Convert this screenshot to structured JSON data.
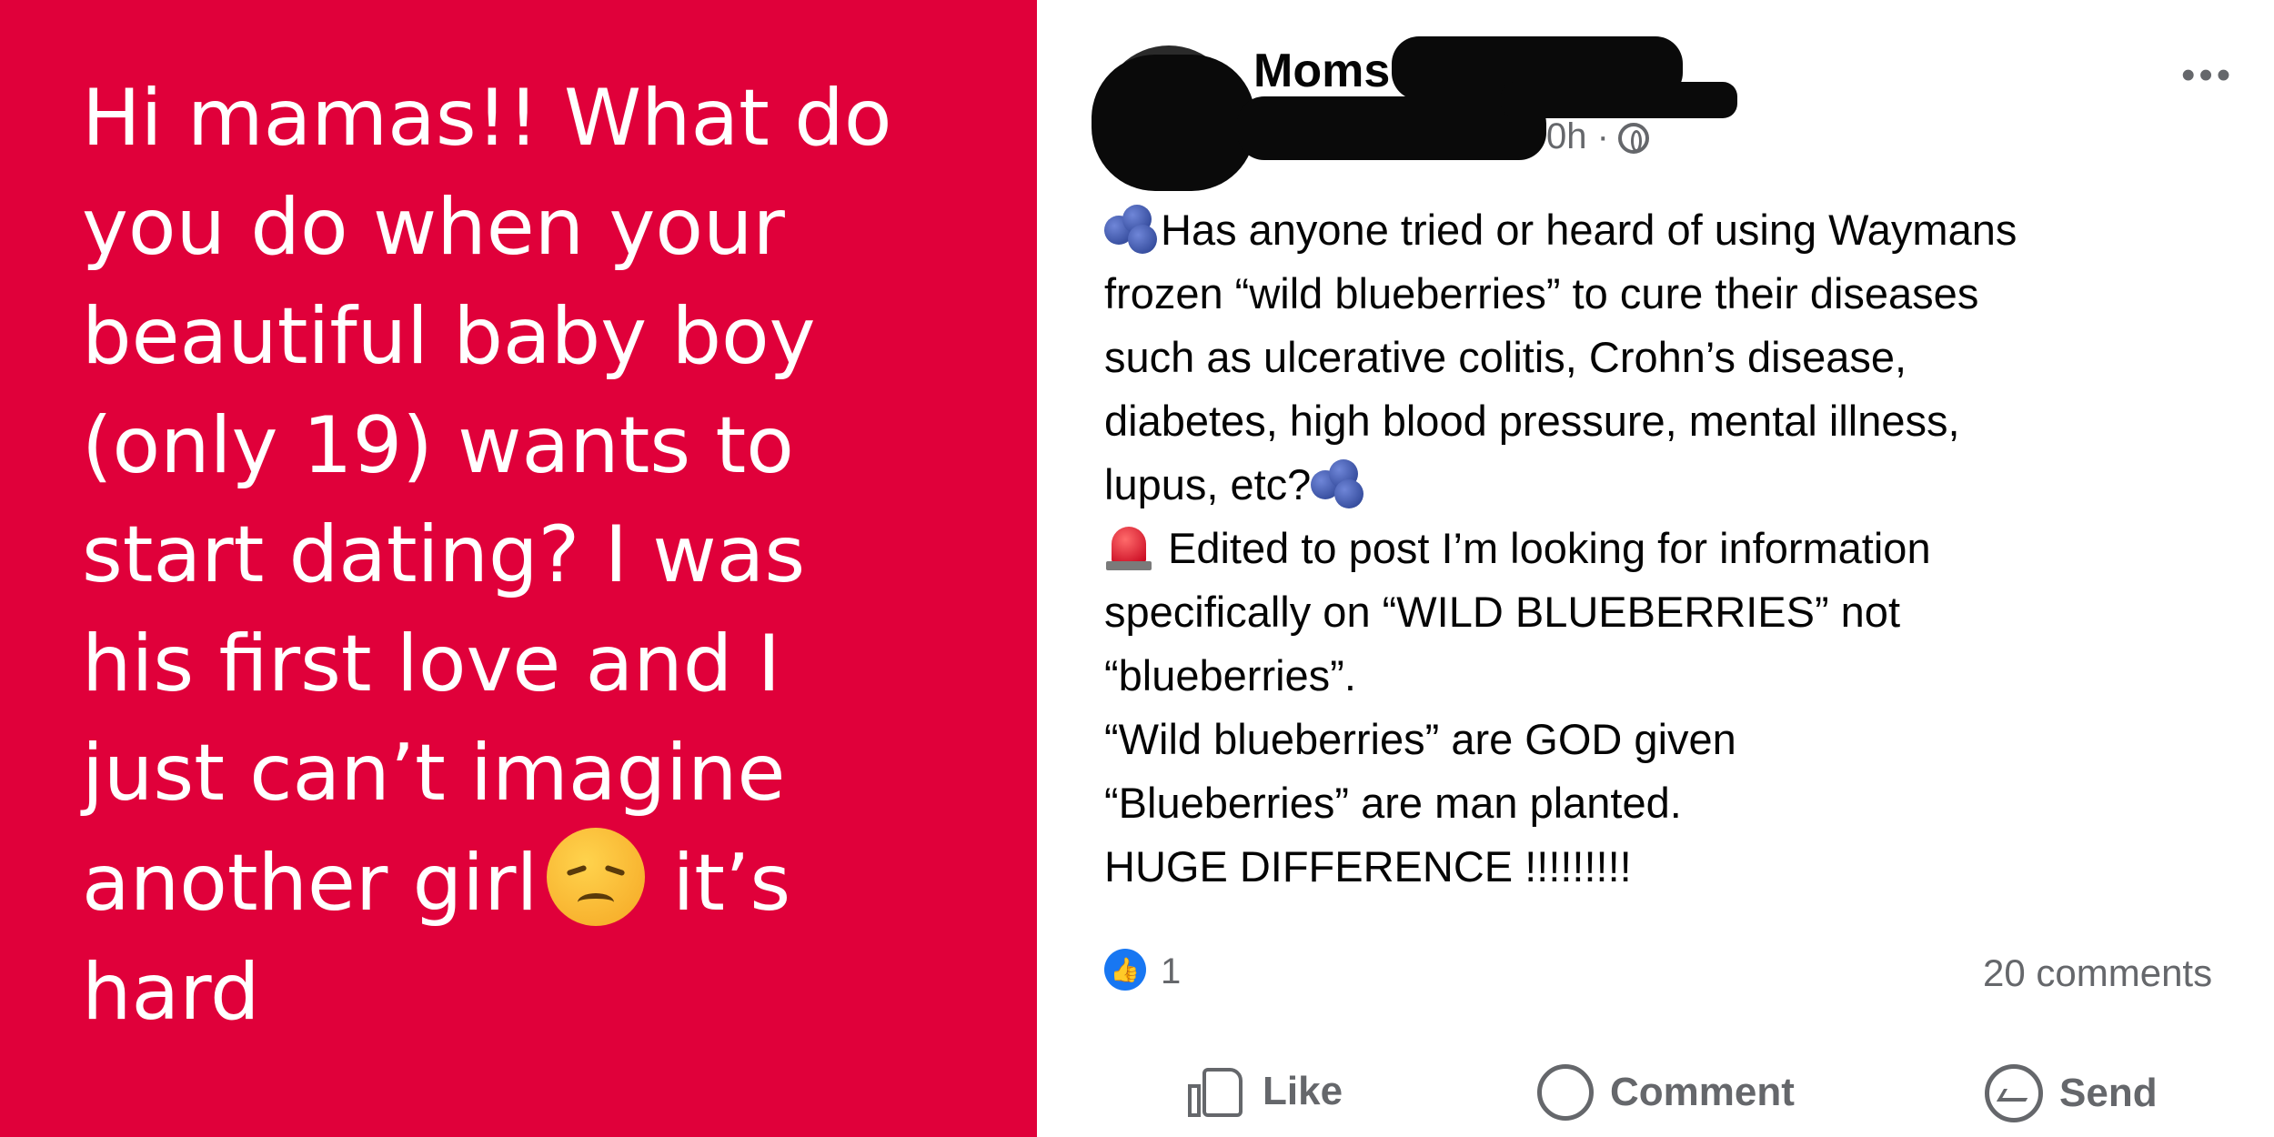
{
  "left_panel": {
    "background": "#e0003a",
    "lines": [
      "Hi mamas!! What do",
      "you do when your",
      "beautiful baby boy",
      "(only 19) wants to",
      "start dating? I was",
      "his first love and I",
      "just can’t imagine",
      "another girl",
      "it’s",
      "hard"
    ],
    "emoji": "pensive-face-icon"
  },
  "post": {
    "group_name": "Moms",
    "timestamp": "0h ·",
    "privacy_icon": "globe-icon",
    "menu_icon": "more-options-icon",
    "more_label": "•••",
    "body_lines": [
      "Has anyone tried or heard of using Waymans",
      "frozen “wild blueberries” to cure their diseases",
      "such as ulcerative colitis, Crohn’s disease,",
      "diabetes, high blood pressure, mental illness,",
      "lupus, etc?",
      "Edited to post I’m looking for information",
      "specifically on “WILD BLUEBERRIES” not",
      "“blueberries”.",
      "“Wild blueberries” are GOD given",
      "“Blueberries” are man planted.",
      "HUGE DIFFERENCE !!!!!!!!!"
    ],
    "reactions": {
      "icon": "like-reaction-icon",
      "glyph": "👍",
      "count": "1"
    },
    "comment_count": "20 comments",
    "actions": {
      "like": "Like",
      "comment": "Comment",
      "send": "Send"
    }
  },
  "colors": {
    "facebook_blue": "#1877f2",
    "meta_gray": "#65676b",
    "redaction": "#0a0a0a"
  }
}
